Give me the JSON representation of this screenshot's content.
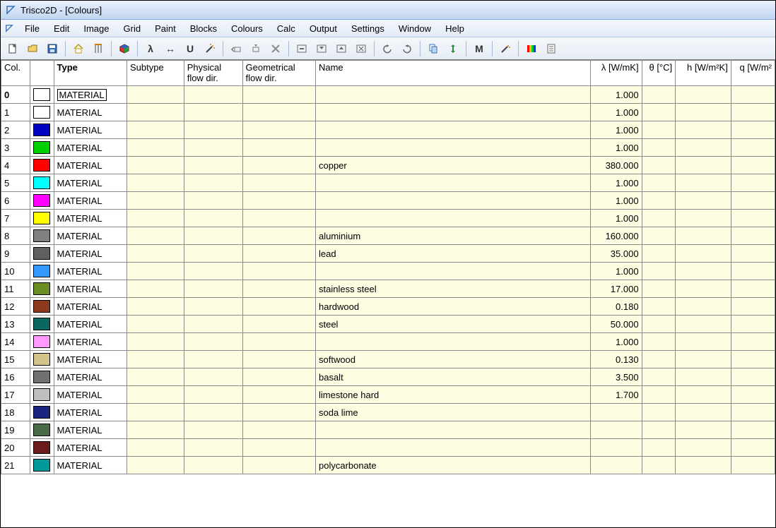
{
  "title": "Trisco2D - [Colours]",
  "menus": [
    "File",
    "Edit",
    "Image",
    "Grid",
    "Paint",
    "Blocks",
    "Colours",
    "Calc",
    "Output",
    "Settings",
    "Window",
    "Help"
  ],
  "toolbar_letters": {
    "lambda": "λ",
    "arrow_h": "↔",
    "u": "U",
    "m": "M"
  },
  "columns": {
    "col": "Col.",
    "type": "Type",
    "subtype": "Subtype",
    "physical": "Physical flow dir.",
    "geometrical": "Geometrical flow dir.",
    "name": "Name",
    "lambda": "λ [W/mK]",
    "theta": "θ [°C]",
    "h": "h [W/m²K]",
    "q": "q [W/m²"
  },
  "rows": [
    {
      "id": "0",
      "swatch": "#ffffff",
      "type": "MATERIAL",
      "type_boxed": true,
      "name": "",
      "lambda": "1.000"
    },
    {
      "id": "1",
      "swatch": "#ffffff",
      "type": "MATERIAL",
      "type_boxed": false,
      "name": "",
      "lambda": "1.000"
    },
    {
      "id": "2",
      "swatch": "#0000c0",
      "type": "MATERIAL",
      "type_boxed": false,
      "name": "",
      "lambda": "1.000"
    },
    {
      "id": "3",
      "swatch": "#00d000",
      "type": "MATERIAL",
      "type_boxed": false,
      "name": "",
      "lambda": "1.000"
    },
    {
      "id": "4",
      "swatch": "#ff0000",
      "type": "MATERIAL",
      "type_boxed": false,
      "name": "copper",
      "lambda": "380.000"
    },
    {
      "id": "5",
      "swatch": "#00ffff",
      "type": "MATERIAL",
      "type_boxed": false,
      "name": "",
      "lambda": "1.000"
    },
    {
      "id": "6",
      "swatch": "#ff00ff",
      "type": "MATERIAL",
      "type_boxed": false,
      "name": "",
      "lambda": "1.000"
    },
    {
      "id": "7",
      "swatch": "#ffff00",
      "type": "MATERIAL",
      "type_boxed": false,
      "name": "",
      "lambda": "1.000"
    },
    {
      "id": "8",
      "swatch": "#808080",
      "type": "MATERIAL",
      "type_boxed": false,
      "name": "aluminium",
      "lambda": "160.000"
    },
    {
      "id": "9",
      "swatch": "#606060",
      "type": "MATERIAL",
      "type_boxed": false,
      "name": "lead",
      "lambda": "35.000"
    },
    {
      "id": "10",
      "swatch": "#3399ff",
      "type": "MATERIAL",
      "type_boxed": false,
      "name": "",
      "lambda": "1.000"
    },
    {
      "id": "11",
      "swatch": "#6b8e23",
      "type": "MATERIAL",
      "type_boxed": false,
      "name": "stainless steel",
      "lambda": "17.000"
    },
    {
      "id": "12",
      "swatch": "#8b3a1e",
      "type": "MATERIAL",
      "type_boxed": false,
      "name": "hardwood",
      "lambda": "0.180"
    },
    {
      "id": "13",
      "swatch": "#0a6761",
      "type": "MATERIAL",
      "type_boxed": false,
      "name": "steel",
      "lambda": "50.000"
    },
    {
      "id": "14",
      "swatch": "#ff99ff",
      "type": "MATERIAL",
      "type_boxed": false,
      "name": "",
      "lambda": "1.000"
    },
    {
      "id": "15",
      "swatch": "#d2c48a",
      "type": "MATERIAL",
      "type_boxed": false,
      "name": "softwood",
      "lambda": "0.130"
    },
    {
      "id": "16",
      "swatch": "#707070",
      "type": "MATERIAL",
      "type_boxed": false,
      "name": "basalt",
      "lambda": "3.500"
    },
    {
      "id": "17",
      "swatch": "#bfbfbf",
      "type": "MATERIAL",
      "type_boxed": false,
      "name": "limestone hard",
      "lambda": "1.700"
    },
    {
      "id": "18",
      "swatch": "#1a237e",
      "type": "MATERIAL",
      "type_boxed": false,
      "name": "soda lime",
      "lambda": ""
    },
    {
      "id": "19",
      "swatch": "#4a6b4a",
      "type": "MATERIAL",
      "type_boxed": false,
      "name": "",
      "lambda": ""
    },
    {
      "id": "20",
      "swatch": "#6b1b1b",
      "type": "MATERIAL",
      "type_boxed": false,
      "name": "",
      "lambda": ""
    },
    {
      "id": "21",
      "swatch": "#009999",
      "type": "MATERIAL",
      "type_boxed": false,
      "name": "polycarbonate",
      "lambda": ""
    }
  ],
  "selected_row": 0
}
